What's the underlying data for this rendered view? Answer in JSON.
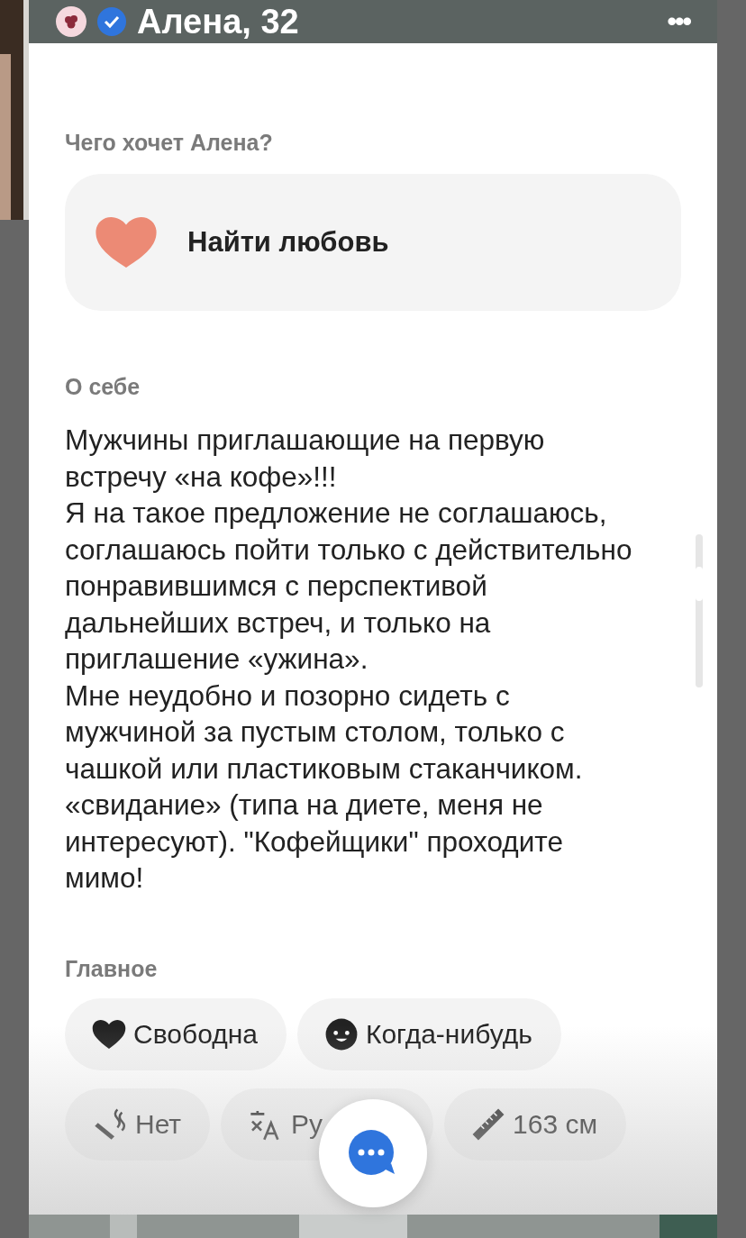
{
  "header": {
    "name": "Алена, 32",
    "verified": true,
    "menu": "•••"
  },
  "goal": {
    "title": "Чего хочет Алена?",
    "text": "Найти любовь"
  },
  "about": {
    "title": "О себе",
    "text": "Мужчины приглашающие на первую встречу «на кофе»!!!\nЯ на такое предложение не соглашаюсь, соглашаюсь пойти только с действительно понравившимся с перспективой дальнейших встреч, и только на приглашение «ужина».\nМне неудобно и позорно сидеть с мужчиной за пустым столом, только с чашкой или пластиковым стаканчиком.\n«свидание» (типа на диете, меня не интересуют). \"Кофейщики\" проходите мимо!"
  },
  "main": {
    "title": "Главное",
    "chips": [
      {
        "kind": "heart",
        "text": "Свободна"
      },
      {
        "kind": "baby",
        "text": "Когда-нибудь"
      },
      {
        "kind": "smoking",
        "text": "Нет"
      },
      {
        "kind": "language",
        "text": "Ру"
      },
      {
        "kind": "height",
        "text": "163 см"
      }
    ]
  }
}
